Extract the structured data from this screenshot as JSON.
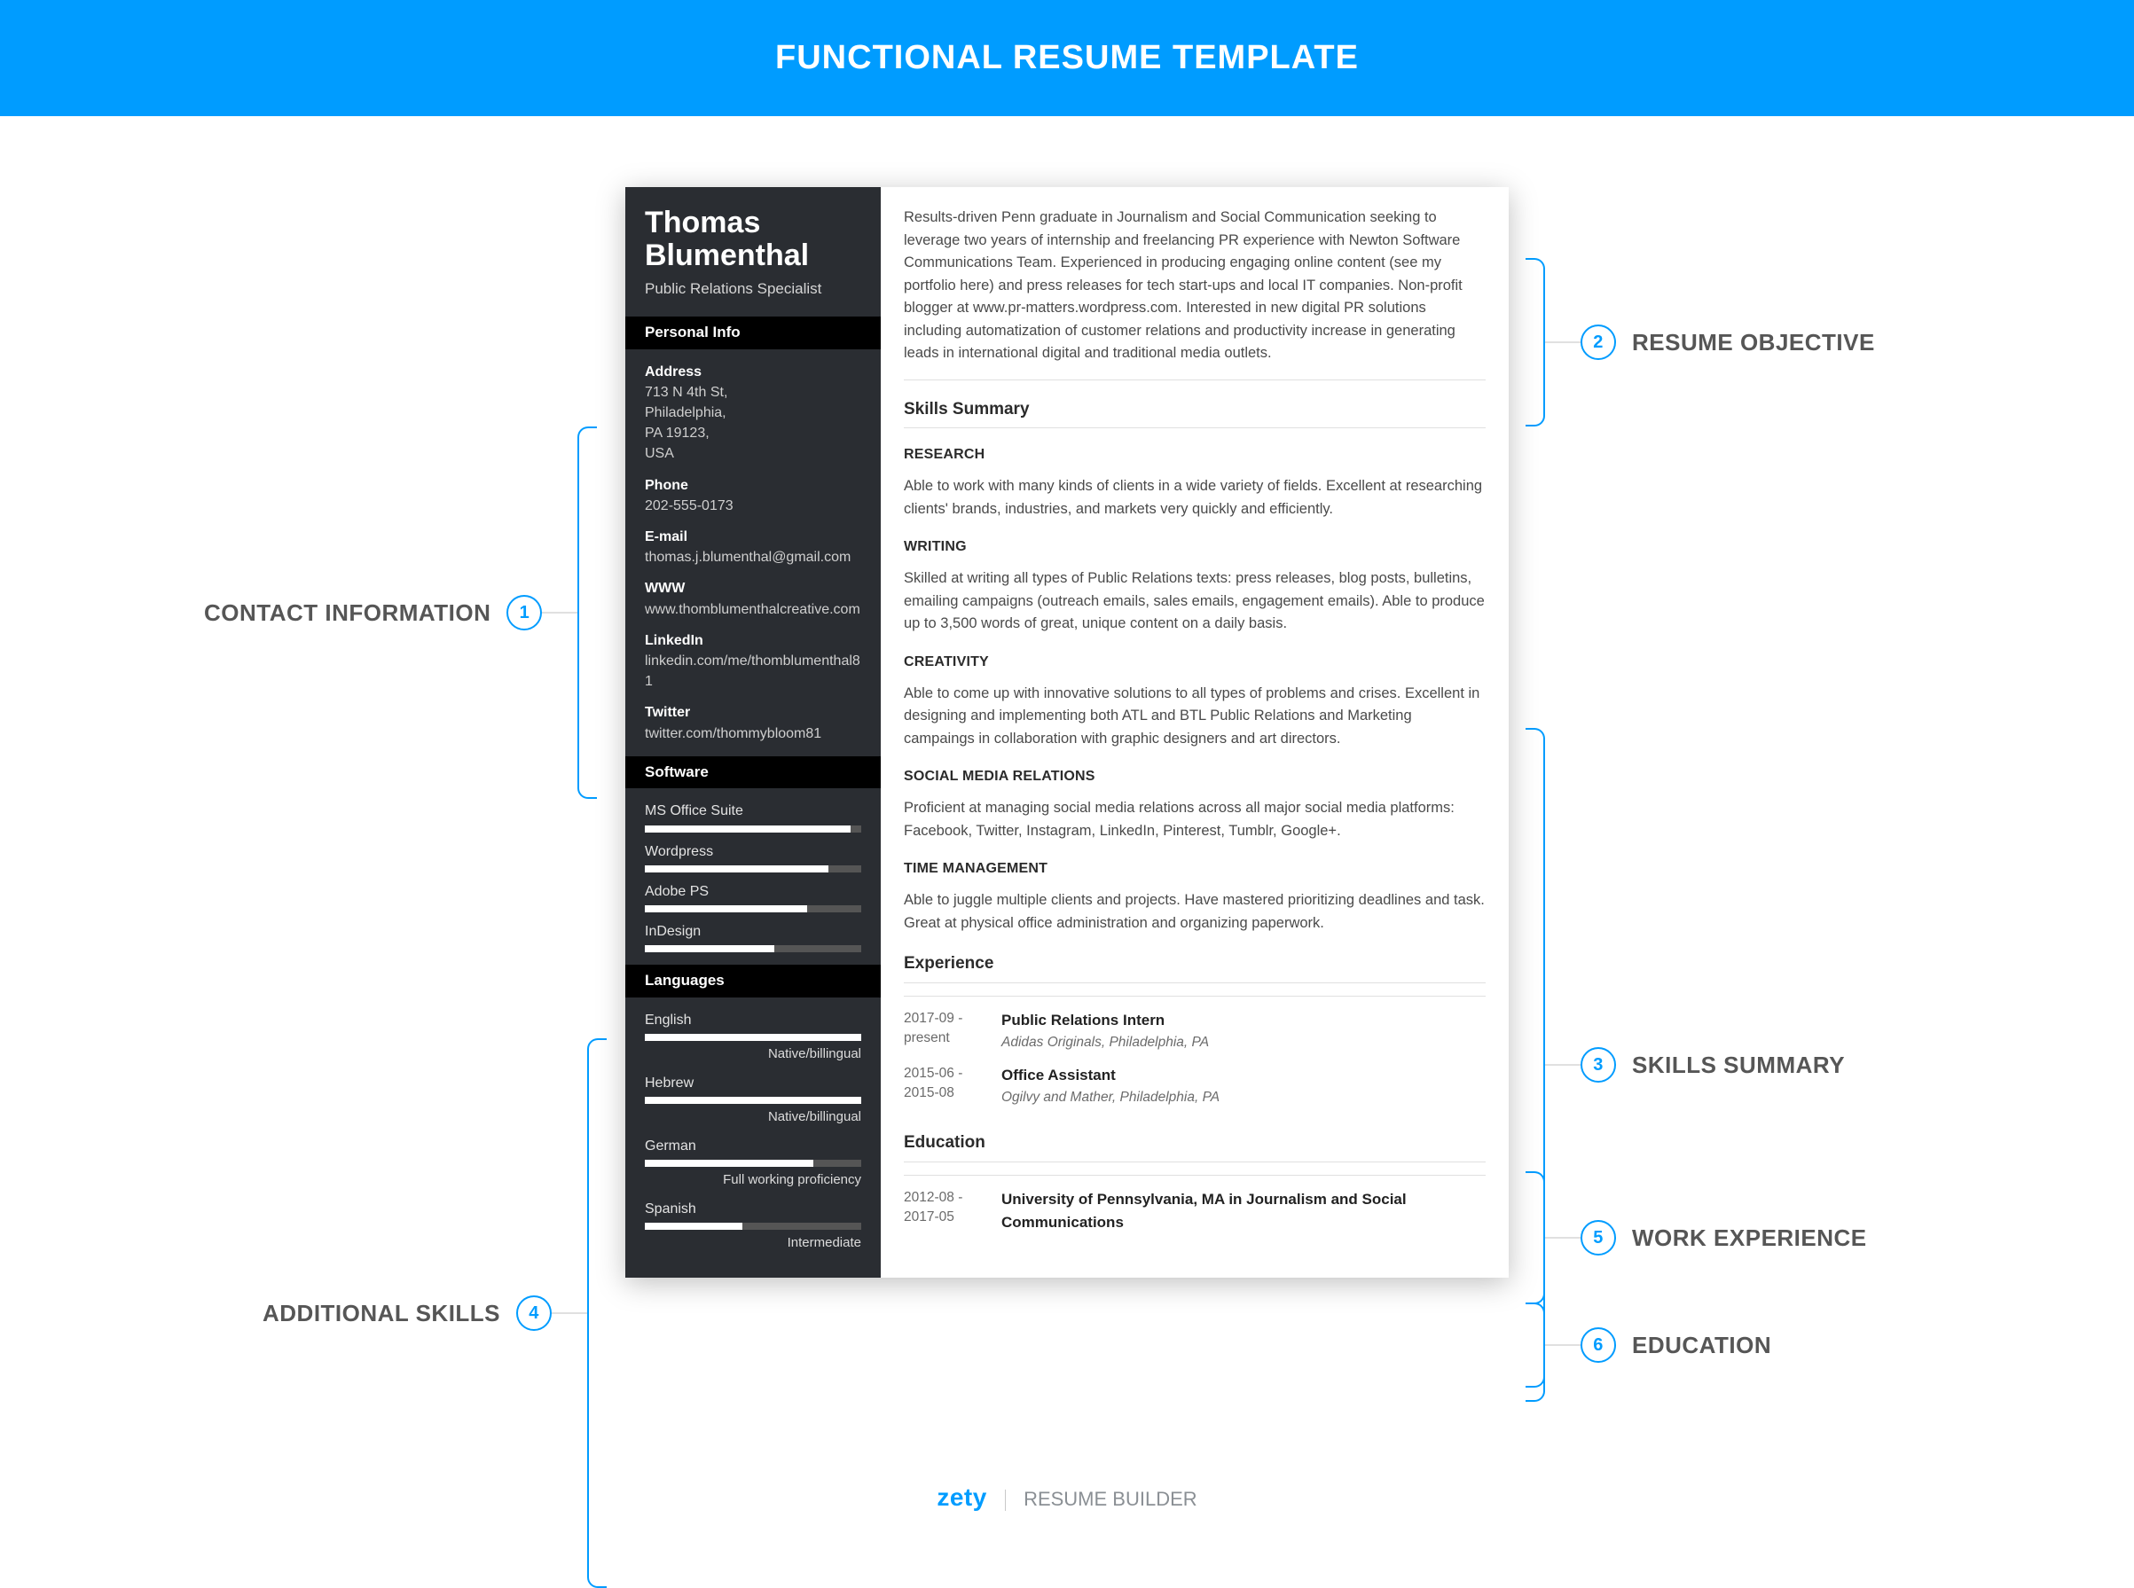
{
  "banner": {
    "title": "FUNCTIONAL RESUME TEMPLATE"
  },
  "callouts": {
    "c1": {
      "num": "1",
      "label": "CONTACT INFORMATION"
    },
    "c2": {
      "num": "2",
      "label": "RESUME OBJECTIVE"
    },
    "c3": {
      "num": "3",
      "label": "SKILLS SUMMARY"
    },
    "c4": {
      "num": "4",
      "label": "ADDITIONAL SKILLS"
    },
    "c5": {
      "num": "5",
      "label": "WORK EXPERIENCE"
    },
    "c6": {
      "num": "6",
      "label": "EDUCATION"
    }
  },
  "sidebar": {
    "name": "Thomas Blumenthal",
    "role": "Public Relations Specialist",
    "personal_info_header": "Personal Info",
    "address_label": "Address",
    "address_l1": "713 N 4th St,",
    "address_l2": "Philadelphia,",
    "address_l3": "PA 19123,",
    "address_l4": "USA",
    "phone_label": "Phone",
    "phone": "202-555-0173",
    "email_label": "E-mail",
    "email": "thomas.j.blumenthal@gmail.com",
    "www_label": "WWW",
    "www": "www.thomblumenthalcreative.com",
    "linkedin_label": "LinkedIn",
    "linkedin": "linkedin.com/me/thomblumenthal81",
    "twitter_label": "Twitter",
    "twitter": "twitter.com/thommybloom81",
    "software_header": "Software",
    "software": [
      {
        "name": "MS Office Suite",
        "pct": 95
      },
      {
        "name": "Wordpress",
        "pct": 85
      },
      {
        "name": "Adobe PS",
        "pct": 75
      },
      {
        "name": "InDesign",
        "pct": 60
      }
    ],
    "languages_header": "Languages",
    "languages": [
      {
        "name": "English",
        "pct": 100,
        "note": "Native/billingual"
      },
      {
        "name": "Hebrew",
        "pct": 100,
        "note": "Native/billingual"
      },
      {
        "name": "German",
        "pct": 78,
        "note": "Full working proficiency"
      },
      {
        "name": "Spanish",
        "pct": 45,
        "note": "Intermediate"
      }
    ]
  },
  "main": {
    "objective": "Results-driven Penn graduate in Journalism and Social Communication seeking to leverage two years of internship and freelancing PR experience with Newton Software Communications Team. Experienced in producing engaging online content (see my portfolio here) and press releases for tech start-ups and local IT companies. Non-profit blogger at www.pr-matters.wordpress.com. Interested in new digital PR solutions including automatization of customer relations and productivity increase in generating leads in international digital and traditional media outlets.",
    "skills_header": "Skills Summary",
    "skills": [
      {
        "title": "RESEARCH",
        "body": "Able to work with many kinds of clients in a wide variety of fields. Excellent at researching clients' brands, industries, and markets very quickly and efficiently."
      },
      {
        "title": "WRITING",
        "body": "Skilled at writing all types of Public Relations texts: press releases, blog posts, bulletins, emailing campaigns (outreach emails, sales emails, engagement emails). Able to produce up to 3,500 words of great, unique content on a daily basis."
      },
      {
        "title": "CREATIVITY",
        "body": "Able to come up with innovative solutions to all types of problems and crises. Excellent in designing and implementing both ATL and BTL Public Relations and Marketing campaings in collaboration with graphic designers and art directors."
      },
      {
        "title": "SOCIAL MEDIA RELATIONS",
        "body": "Proficient at managing social media relations across all major social media platforms: Facebook, Twitter, Instagram, LinkedIn, Pinterest, Tumblr, Google+."
      },
      {
        "title": "TIME MANAGEMENT",
        "body": "Able to juggle multiple clients and projects. Have mastered prioritizing deadlines and task. Great at physical office administration and organizing paperwork."
      }
    ],
    "experience_header": "Experience",
    "experience": [
      {
        "date": "2017-09 - present",
        "title": "Public Relations Intern",
        "org": "Adidas Originals, Philadelphia, PA"
      },
      {
        "date": "2015-06 - 2015-08",
        "title": "Office Assistant",
        "org": "Ogilvy and Mather, Philadelphia, PA"
      }
    ],
    "education_header": "Education",
    "education": [
      {
        "date": "2012-08 - 2017-05",
        "title": "University of Pennsylvania, MA in Journalism and Social Communications"
      }
    ]
  },
  "footer": {
    "brand": "zety",
    "tagline": "RESUME BUILDER"
  }
}
